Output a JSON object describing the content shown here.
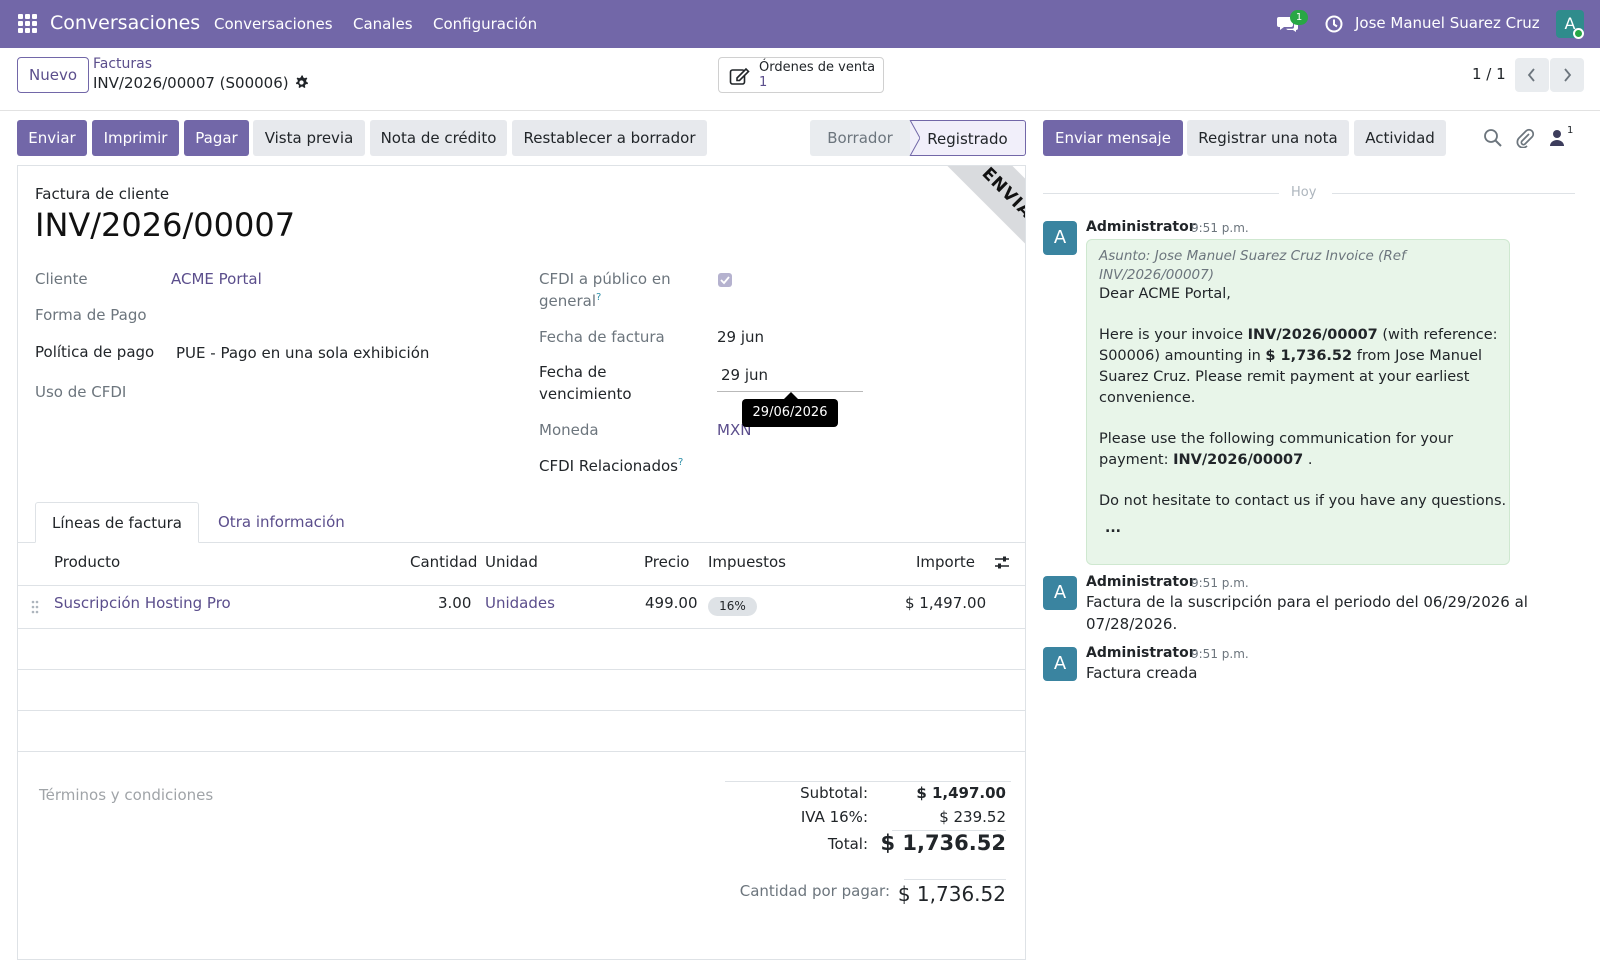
{
  "navbar": {
    "app_name": "Conversaciones",
    "menu": [
      "Conversaciones",
      "Canales",
      "Configuración"
    ],
    "chat_count": "1",
    "user_name": "Jose Manuel Suarez Cruz",
    "avatar_letter": "A"
  },
  "control_panel": {
    "new_label": "Nuevo",
    "breadcrumb_parent": "Facturas",
    "record_name": "INV/2026/00007 (S00006)",
    "smart_button": {
      "label": "Órdenes de venta",
      "count": "1"
    },
    "pager": "1 / 1"
  },
  "actions": {
    "send": "Enviar",
    "print": "Imprimir",
    "pay": "Pagar",
    "preview": "Vista previa",
    "credit_note": "Nota de crédito",
    "reset_draft": "Restablecer a borrador"
  },
  "status": {
    "stages": [
      "Borrador",
      "Registrado"
    ],
    "current": "Registrado"
  },
  "invoice": {
    "type_label": "Factura de cliente",
    "number": "INV/2026/00007",
    "ribbon": "ENVIADO",
    "fields_left": {
      "customer_label": "Cliente",
      "customer_value": "ACME Portal",
      "payment_form_label": "Forma de Pago",
      "payment_policy_label": "Política de pago",
      "payment_policy_value": "PUE - Pago en una sola exhibición",
      "cfdi_use_label": "Uso de CFDI"
    },
    "fields_right": {
      "cfdi_public_label_1": "CFDI a público en",
      "cfdi_public_label_2": "general",
      "cfdi_public_checked": true,
      "invoice_date_label": "Fecha de factura",
      "invoice_date_value": "29 jun",
      "due_date_label_1": "Fecha de",
      "due_date_label_2": "vencimiento",
      "due_date_value": "29 jun",
      "due_date_tooltip": "29/06/2026",
      "currency_label": "Moneda",
      "currency_value": "MXN",
      "related_cfdi_label": "CFDI Relacionados"
    },
    "help_mark": "?",
    "tabs": [
      "Líneas de factura",
      "Otra información"
    ],
    "columns": [
      "Producto",
      "Cantidad",
      "Unidad",
      "Precio",
      "Impuestos",
      "Importe"
    ],
    "lines": [
      {
        "product": "Suscripción Hosting Pro",
        "quantity": "3.00",
        "unit": "Unidades",
        "price": "499.00",
        "tax": "16%",
        "amount": "$ 1,497.00"
      }
    ],
    "terms_placeholder": "Términos y condiciones",
    "totals": {
      "subtotal_label": "Subtotal:",
      "subtotal_value": "$ 1,497.00",
      "tax_label": "IVA 16%:",
      "tax_value": "$ 239.52",
      "total_label": "Total:",
      "total_value": "$ 1,736.52",
      "due_label": "Cantidad por pagar:",
      "due_value": "$ 1,736.52"
    }
  },
  "chatter": {
    "send_message": "Enviar mensaje",
    "log_note": "Registrar una nota",
    "activity": "Actividad",
    "followers_count": "1",
    "day_separator": "Hoy",
    "messages": [
      {
        "author": "Administrator",
        "time": "9:51 p.m.",
        "avatar": "A",
        "subject_1": "Asunto: Jose Manuel Suarez Cruz Invoice (Ref",
        "subject_2": "INV/2026/00007)",
        "greeting": "Dear ACME Portal,",
        "p1_a": "Here is your invoice ",
        "p1_b": "INV/2026/00007",
        "p1_c": " (with reference:",
        "p1_d": "S00006) amounting in ",
        "p1_e": "$ 1,736.52",
        "p1_f": " from Jose Manuel",
        "p1_g": "Suarez Cruz. Please remit payment at your earliest",
        "p1_h": "convenience.",
        "p2_a": "Please use the following communication for your",
        "p2_b": "payment: ",
        "p2_c": "INV/2026/00007",
        "p2_d": " .",
        "p3": "Do not hesitate to contact us if you have any questions.",
        "more": "..."
      },
      {
        "author": "Administrator",
        "time": "9:51 p.m.",
        "avatar": "A",
        "body_1": "Factura de la suscripción para el periodo del 06/29/2026 al",
        "body_2": "07/28/2026."
      },
      {
        "author": "Administrator",
        "time": "9:51 p.m.",
        "avatar": "A",
        "body_1": "Factura creada"
      }
    ]
  }
}
